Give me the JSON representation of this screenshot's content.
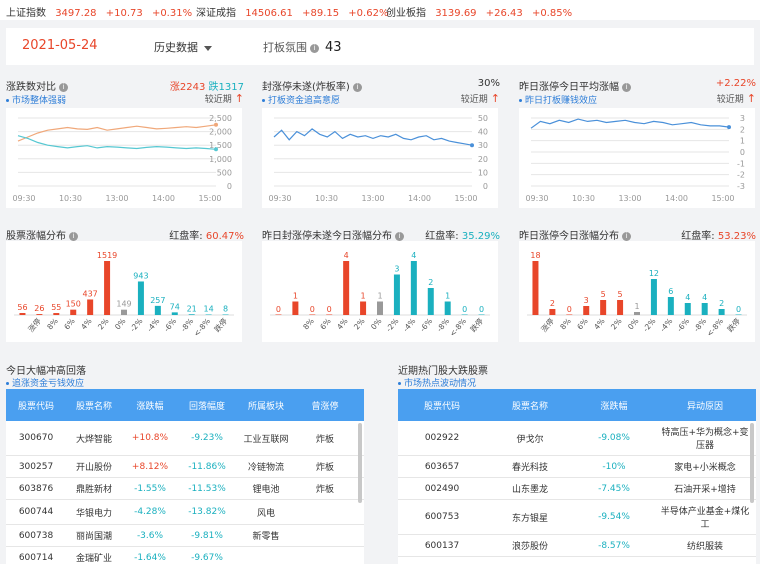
{
  "ticker": [
    {
      "name": "上证指数",
      "price": "3497.28",
      "change": "+10.73",
      "pct": "+0.31%"
    },
    {
      "name": "深证成指",
      "price": "14506.61",
      "change": "+89.15",
      "pct": "+0.62%"
    },
    {
      "name": "创业板指",
      "price": "3139.69",
      "change": "+26.43",
      "pct": "+0.85%"
    }
  ],
  "header": {
    "date": "2021-05-24",
    "history_label": "历史数据",
    "mood_label": "打板氛围",
    "mood_value": "43"
  },
  "panels": {
    "p1": {
      "title": "涨跌数对比",
      "sub": "市场整体强弱",
      "up": "涨2243",
      "down": "跌1317",
      "recent": "较近期"
    },
    "p2": {
      "title": "封涨停未遂(炸板率)",
      "sub": "打板资金追高意愿",
      "value": "30%",
      "recent": "较近期"
    },
    "p3": {
      "title": "昨日涨停今日平均涨幅",
      "sub": "昨日打板赚钱效应",
      "value": "+2.22%",
      "recent": "较近期"
    }
  },
  "dist": {
    "d1": {
      "title": "股票涨幅分布",
      "rate_label": "红盘率:",
      "rate": "60.47%"
    },
    "d2": {
      "title": "昨日封涨停未遂今日涨幅分布",
      "rate_label": "红盘率:",
      "rate": "35.29%"
    },
    "d3": {
      "title": "昨日涨停今日涨幅分布",
      "rate_label": "红盘率:",
      "rate": "53.23%"
    }
  },
  "chart_data": [
    {
      "type": "line",
      "x": [
        "09:30",
        "10:30",
        "13:00",
        "14:00",
        "15:00"
      ],
      "ylim": [
        0,
        2500
      ],
      "yticks": [
        "2,500",
        "2,000",
        "1,500",
        "1,000",
        "500",
        "0"
      ],
      "series": [
        {
          "values": [
            1650,
            1800,
            1950,
            2050,
            2100,
            2150,
            2100,
            2080,
            2150,
            2050,
            2100,
            2150,
            2200,
            2150,
            2100,
            2120,
            2150,
            2180,
            2150,
            2200,
            2250
          ],
          "color": "#f0a87a"
        },
        {
          "values": [
            1850,
            1750,
            1600,
            1500,
            1450,
            1400,
            1450,
            1480,
            1400,
            1450,
            1430,
            1400,
            1380,
            1420,
            1450,
            1430,
            1400,
            1380,
            1400,
            1380,
            1350
          ],
          "color": "#56c8d2"
        }
      ]
    },
    {
      "type": "line",
      "x": [
        "09:30",
        "10:30",
        "13:00",
        "14:00",
        "15:00"
      ],
      "ylim": [
        0,
        50
      ],
      "yticks": [
        "50",
        "40",
        "30",
        "20",
        "10",
        "0"
      ],
      "series": [
        {
          "values": [
            36,
            41,
            34,
            40,
            37,
            42,
            38,
            36,
            40,
            35,
            38,
            36,
            37,
            35,
            37,
            36,
            38,
            35,
            34,
            36,
            37,
            34,
            35,
            33,
            32,
            31,
            30
          ],
          "color": "#4a90d9"
        }
      ]
    },
    {
      "type": "line",
      "x": [
        "09:30",
        "10:30",
        "13:00",
        "14:00",
        "15:00"
      ],
      "ylim": [
        -3,
        3
      ],
      "yticks": [
        "3",
        "2",
        "1",
        "0",
        "-1",
        "-2",
        "-3"
      ],
      "series": [
        {
          "values": [
            2.1,
            2.7,
            2.5,
            2.8,
            2.6,
            2.9,
            2.7,
            2.8,
            2.6,
            2.7,
            2.8,
            2.6,
            2.5,
            2.7,
            2.6,
            2.4,
            2.5,
            2.6,
            2.4,
            2.3,
            2.3,
            2.2
          ],
          "color": "#4a90d9"
        }
      ]
    },
    {
      "type": "bar",
      "categories": [
        "涨停",
        "8%",
        "6%",
        "4%",
        "2%",
        "0%",
        "-2%",
        "-4%",
        "-6%",
        "-8%",
        "<-8%",
        "跌停"
      ],
      "values": [
        56,
        26,
        55,
        150,
        437,
        1519,
        149,
        943,
        257,
        74,
        21,
        14,
        8
      ],
      "bars": [
        {
          "c": "涨停",
          "v": 56,
          "col": "#e8462a",
          "lab": "56"
        },
        {
          "c": ">8%",
          "v": 26,
          "col": "#e8462a",
          "lab": "26"
        },
        {
          "c": "8%",
          "v": 55,
          "col": "#e8462a",
          "lab": "55"
        },
        {
          "c": "6%",
          "v": 150,
          "col": "#e8462a",
          "lab": "150"
        },
        {
          "c": "4%",
          "v": 437,
          "col": "#e8462a",
          "lab": "437"
        },
        {
          "c": "2%",
          "v": 1519,
          "col": "#e8462a",
          "lab": "1519"
        },
        {
          "c": "0%",
          "v": 149,
          "col": "#999999",
          "lab": "149"
        },
        {
          "c": "-2%",
          "v": 943,
          "col": "#1ab0bf",
          "lab": "943"
        },
        {
          "c": "-4%",
          "v": 257,
          "col": "#1ab0bf",
          "lab": "257"
        },
        {
          "c": "-6%",
          "v": 74,
          "col": "#1ab0bf",
          "lab": "74"
        },
        {
          "c": "-8%",
          "v": 21,
          "col": "#1ab0bf",
          "lab": "21"
        },
        {
          "c": "<-8%",
          "v": 14,
          "col": "#1ab0bf",
          "lab": "14"
        },
        {
          "c": "跌停",
          "v": 8,
          "col": "#1ab0bf",
          "lab": "8"
        }
      ],
      "xlabels": [
        "涨停",
        "8%",
        "6%",
        "4%",
        "2%",
        "0%",
        "-2%",
        "-4%",
        "-6%",
        "-8%",
        "<-8%",
        "跌停"
      ]
    },
    {
      "type": "bar",
      "bars": [
        {
          "v": 0,
          "col": "#e8462a",
          "lab": "0"
        },
        {
          "v": 1,
          "col": "#e8462a",
          "lab": "1"
        },
        {
          "v": 0,
          "col": "#e8462a",
          "lab": "0"
        },
        {
          "v": 0,
          "col": "#e8462a",
          "lab": "0"
        },
        {
          "v": 4,
          "col": "#e8462a",
          "lab": "4"
        },
        {
          "v": 1,
          "col": "#e8462a",
          "lab": "1"
        },
        {
          "v": 1,
          "col": "#999999",
          "lab": "1"
        },
        {
          "v": 3,
          "col": "#1ab0bf",
          "lab": "3"
        },
        {
          "v": 4,
          "col": "#1ab0bf",
          "lab": "4"
        },
        {
          "v": 2,
          "col": "#1ab0bf",
          "lab": "2"
        },
        {
          "v": 1,
          "col": "#1ab0bf",
          "lab": "1"
        },
        {
          "v": 0,
          "col": "#1ab0bf",
          "lab": "0"
        },
        {
          "v": 0,
          "col": "#1ab0bf",
          "lab": "0"
        }
      ],
      "xlabels": [
        "8%",
        "6%",
        "4%",
        "2%",
        "0%",
        "-2%",
        "-4%",
        "-6%",
        "-8%",
        "<-8%",
        "跌停"
      ]
    },
    {
      "type": "bar",
      "bars": [
        {
          "v": 18,
          "col": "#e8462a",
          "lab": "18"
        },
        {
          "v": 2,
          "col": "#e8462a",
          "lab": "2"
        },
        {
          "v": 0,
          "col": "#e8462a",
          "lab": "0"
        },
        {
          "v": 3,
          "col": "#e8462a",
          "lab": "3"
        },
        {
          "v": 5,
          "col": "#e8462a",
          "lab": "5"
        },
        {
          "v": 5,
          "col": "#e8462a",
          "lab": "5"
        },
        {
          "v": 1,
          "col": "#999999",
          "lab": "1"
        },
        {
          "v": 12,
          "col": "#1ab0bf",
          "lab": "12"
        },
        {
          "v": 6,
          "col": "#1ab0bf",
          "lab": "6"
        },
        {
          "v": 4,
          "col": "#1ab0bf",
          "lab": "4"
        },
        {
          "v": 4,
          "col": "#1ab0bf",
          "lab": "4"
        },
        {
          "v": 2,
          "col": "#1ab0bf",
          "lab": "2"
        },
        {
          "v": 0,
          "col": "#1ab0bf",
          "lab": "0"
        }
      ],
      "xlabels": [
        "涨停",
        "8%",
        "6%",
        "4%",
        "2%",
        "0%",
        "-2%",
        "-4%",
        "-6%",
        "-8%",
        "<-8%",
        "跌停"
      ]
    }
  ],
  "left_table": {
    "title": "今日大幅冲高回落",
    "sub": "追涨资金亏钱效应",
    "headers": [
      "股票代码",
      "股票名称",
      "涨跌幅",
      "回落幅度",
      "所属板块",
      "曾涨停"
    ],
    "rows": [
      [
        "300670",
        "大烨智能",
        "+10.8%",
        "-9.23%",
        "工业互联网",
        "炸板"
      ],
      [
        "300257",
        "开山股份",
        "+8.12%",
        "-11.86%",
        "冷链物流",
        "炸板"
      ],
      [
        "603876",
        "鼎胜新材",
        "-1.55%",
        "-11.53%",
        "锂电池",
        "炸板"
      ],
      [
        "600744",
        "华银电力",
        "-4.28%",
        "-13.82%",
        "风电",
        ""
      ],
      [
        "600738",
        "丽尚国潮",
        "-3.6%",
        "-9.81%",
        "新零售",
        ""
      ],
      [
        "600714",
        "金瑞矿业",
        "-1.64%",
        "-9.67%",
        "",
        ""
      ]
    ]
  },
  "right_table": {
    "title": "近期热门股大跌股票",
    "sub": "市场热点波动情况",
    "headers": [
      "股票代码",
      "股票名称",
      "涨跌幅",
      "异动原因"
    ],
    "rows": [
      [
        "002922",
        "伊戈尔",
        "-9.08%",
        "特高压+华为概念+变压器"
      ],
      [
        "603657",
        "春光科技",
        "-10%",
        "家电+小米概念"
      ],
      [
        "002490",
        "山东墨龙",
        "-7.45%",
        "石油开采+增持"
      ],
      [
        "600753",
        "东方银星",
        "-9.54%",
        "半导体产业基金+煤化工"
      ],
      [
        "600137",
        "浪莎股份",
        "-8.57%",
        "纺织服装"
      ]
    ]
  }
}
